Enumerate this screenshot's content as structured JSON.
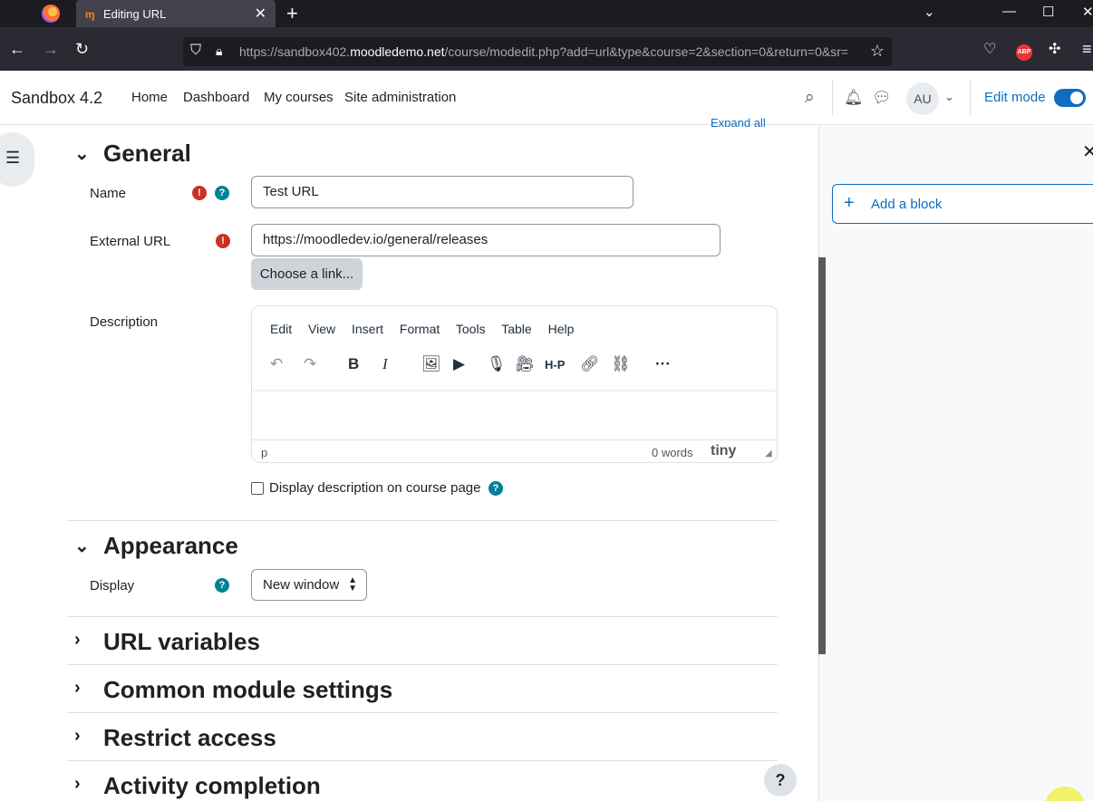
{
  "browser": {
    "tab_title": "Editing URL",
    "new_tab": "+",
    "url_prefix": "https://sandbox402.",
    "url_domain": "moodledemo.net",
    "url_suffix": "/course/modedit.php?add=url&type&course=2&section=0&return=0&sr=",
    "abp_label": "ABP"
  },
  "header": {
    "brand": "Sandbox 4.2",
    "nav": [
      "Home",
      "Dashboard",
      "My courses",
      "Site administration"
    ],
    "avatar_initials": "AU",
    "edit_mode_label": "Edit mode"
  },
  "form": {
    "expand_all": "Expand all",
    "general": {
      "title": "General",
      "name_label": "Name",
      "name_value": "Test URL",
      "url_label": "External URL",
      "url_value": "https://moodledev.io/general/releases",
      "choose_link_button": "Choose a link...",
      "description_label": "Description",
      "editor_menu": [
        "Edit",
        "View",
        "Insert",
        "Format",
        "Tools",
        "Table",
        "Help"
      ],
      "editor_status_element": "p",
      "editor_word_count": "0 words",
      "editor_brand": "tiny",
      "display_description_label": "Display description on course page"
    },
    "appearance": {
      "title": "Appearance",
      "display_label": "Display",
      "display_value": "New window"
    },
    "collapsed_sections": [
      "URL variables",
      "Common module settings",
      "Restrict access",
      "Activity completion"
    ]
  },
  "drawer": {
    "add_block_label": "Add a block"
  },
  "help_fab": "?",
  "colors": {
    "primary": "#0f6cbf",
    "required": "#ca3120",
    "help": "#008196"
  }
}
